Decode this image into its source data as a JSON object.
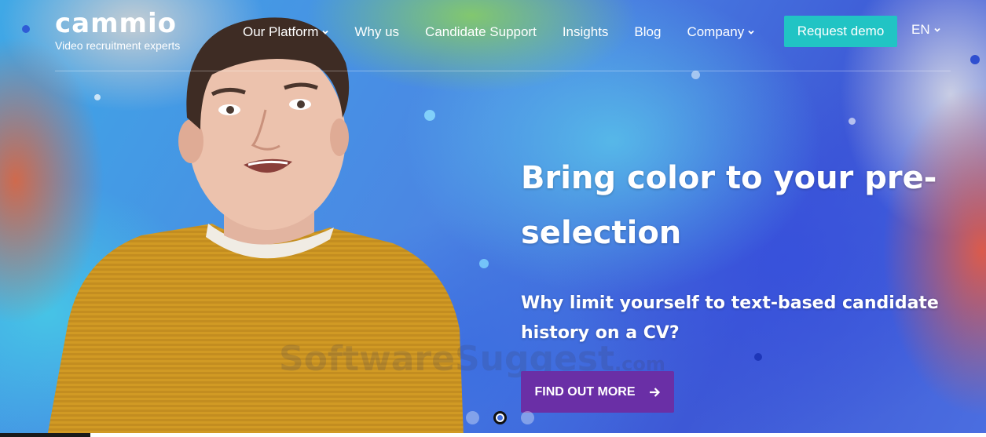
{
  "brand": {
    "name": "cammio",
    "tagline": "Video recruitment experts"
  },
  "nav": {
    "items": [
      {
        "label": "Our Platform",
        "has_dropdown": true
      },
      {
        "label": "Why us",
        "has_dropdown": false
      },
      {
        "label": "Candidate Support",
        "has_dropdown": false
      },
      {
        "label": "Insights",
        "has_dropdown": false
      },
      {
        "label": "Blog",
        "has_dropdown": false
      },
      {
        "label": "Company",
        "has_dropdown": true
      }
    ],
    "cta_label": "Request demo",
    "language": "EN"
  },
  "hero": {
    "headline": "Bring color to your pre-selection",
    "subheadline": "Why limit yourself to text-based candidate history on a CV?",
    "cta_label": "FIND OUT MORE",
    "cta_icon": "arrow-right-icon",
    "slides": 3,
    "active_slide": 2
  },
  "watermark": {
    "text": "SoftwareSuggest",
    "suffix": ".com"
  },
  "colors": {
    "accent_teal": "#21c4c4",
    "cta_purple": "#6a2fa6",
    "sweater": "#d19a24"
  }
}
